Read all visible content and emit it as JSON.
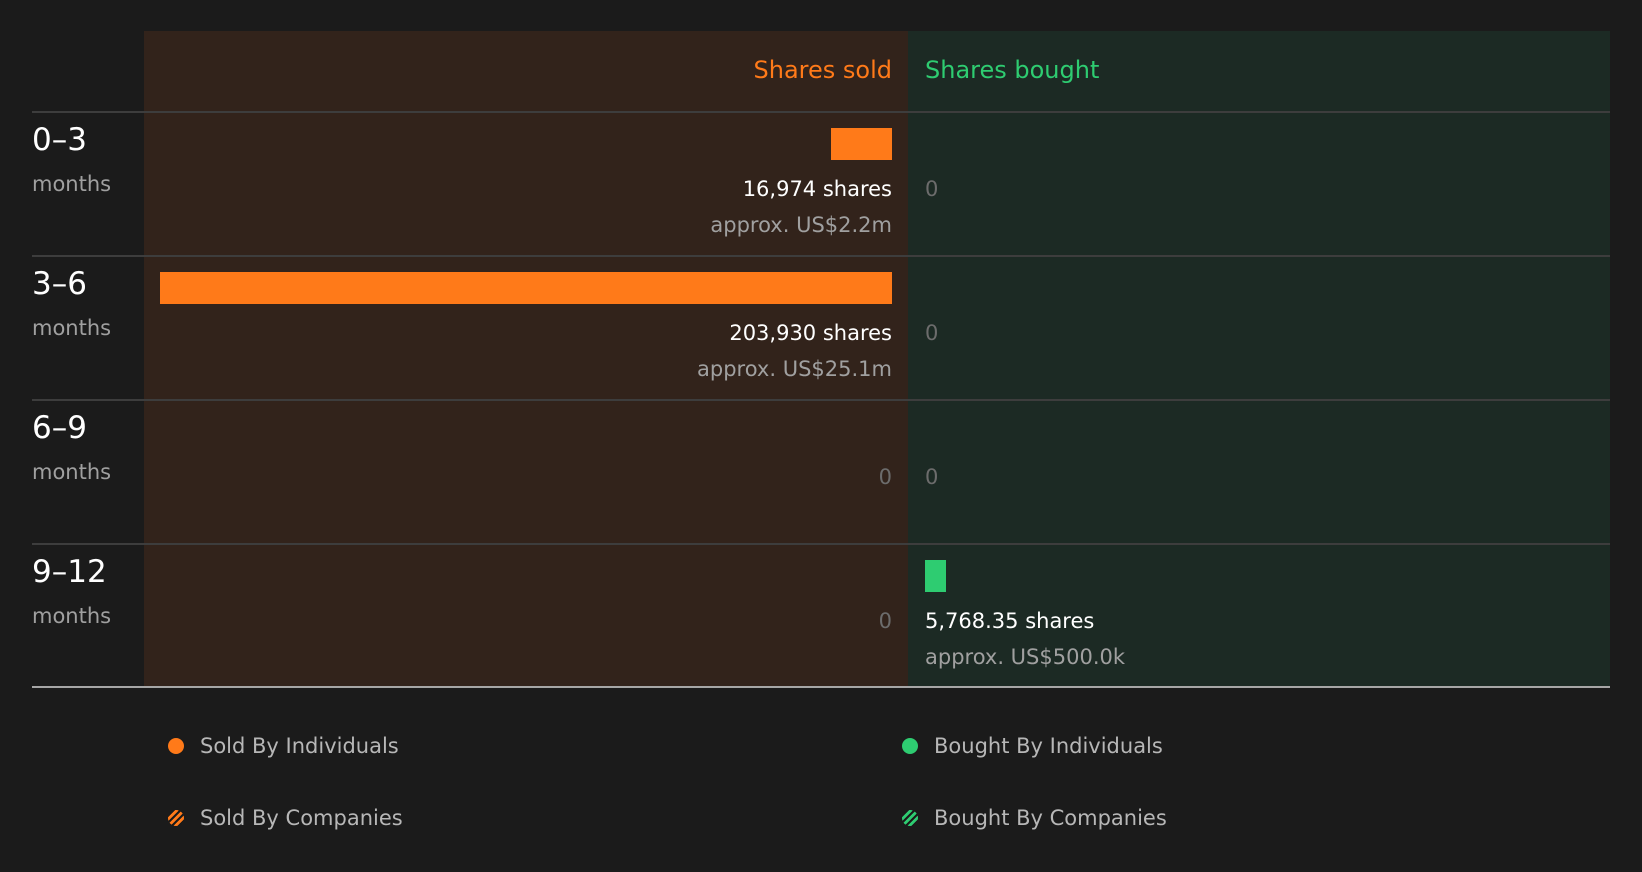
{
  "chart_data": {
    "type": "bar",
    "orientation": "horizontal-diverging",
    "column_headers": {
      "sold": "Shares sold",
      "bought": "Shares bought"
    },
    "periods": [
      {
        "range": "0–3",
        "unit": "months",
        "sold": {
          "shares": 16974,
          "shares_label": "16,974 shares",
          "approx_label": "approx. US$2.2m"
        },
        "bought": {
          "shares": 0,
          "zero_label": "0"
        }
      },
      {
        "range": "3–6",
        "unit": "months",
        "sold": {
          "shares": 203930,
          "shares_label": "203,930 shares",
          "approx_label": "approx. US$25.1m"
        },
        "bought": {
          "shares": 0,
          "zero_label": "0"
        }
      },
      {
        "range": "6–9",
        "unit": "months",
        "sold": {
          "shares": 0,
          "zero_label": "0"
        },
        "bought": {
          "shares": 0,
          "zero_label": "0"
        }
      },
      {
        "range": "9–12",
        "unit": "months",
        "sold": {
          "shares": 0,
          "zero_label": "0"
        },
        "bought": {
          "shares": 5768.35,
          "shares_label": "5,768.35 shares",
          "approx_label": "approx. US$500.0k"
        }
      }
    ],
    "legend": [
      {
        "label": "Sold By Individuals",
        "style": "solid",
        "color": "#ff7a19"
      },
      {
        "label": "Bought By Individuals",
        "style": "solid",
        "color": "#2ecc71"
      },
      {
        "label": "Sold By Companies",
        "style": "striped",
        "color": "#ff7a19"
      },
      {
        "label": "Bought By Companies",
        "style": "striped",
        "color": "#2ecc71"
      }
    ],
    "legend_position": "bottom",
    "colors": {
      "page_bg": "#1b1b1b",
      "sold_panel": "#32231b",
      "bought_panel": "#1c2a24",
      "sold_bar": "#ff7a19",
      "bought_bar": "#2ecc71",
      "sold_header": "#ff7a19",
      "bought_header": "#2ecc71",
      "primary_text": "#ffffff",
      "secondary_text": "#a0a0a0",
      "zero_text": "#6c6c6c",
      "divider": "#3d3d3d",
      "baseline": "#a6a6a6"
    }
  }
}
